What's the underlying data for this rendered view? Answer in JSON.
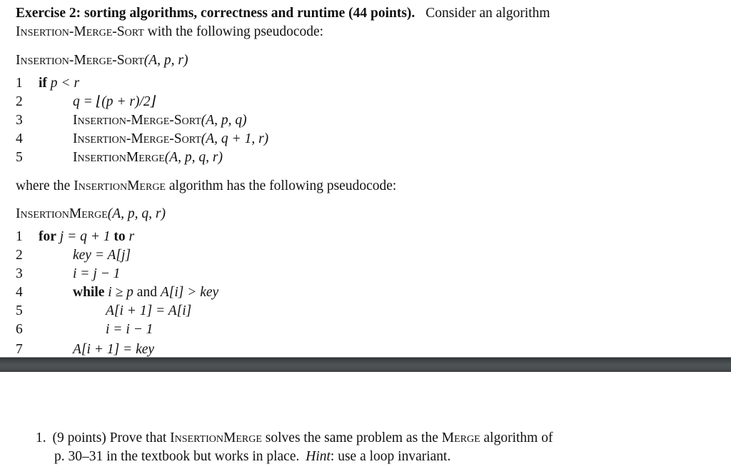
{
  "exercise": {
    "heading_bold": "Exercise 2: sorting algorithms, correctness and runtime (44 points).",
    "heading_rest": "Consider an algorithm",
    "intro_sc": "Insertion-Merge-Sort",
    "intro_rest": "with the following pseudocode:"
  },
  "ims": {
    "title_sc": "Insertion-Merge-Sort",
    "title_args": "(A, p, r)",
    "lines": [
      {
        "num": "1",
        "kw": "if",
        "text": "p < r"
      },
      {
        "num": "2",
        "text": "q = ⌊(p + r)/2⌋"
      },
      {
        "num": "3",
        "sc": "Insertion-Merge-Sort",
        "args": "(A, p, q)"
      },
      {
        "num": "4",
        "sc": "Insertion-Merge-Sort",
        "args": "(A, q + 1, r)"
      },
      {
        "num": "5",
        "sc": "InsertionMerge",
        "args": "(A, p, q, r)"
      }
    ]
  },
  "between": {
    "pre": "where the",
    "sc": "InsertionMerge",
    "post": "algorithm has the following pseudocode:"
  },
  "im": {
    "title_sc": "InsertionMerge",
    "title_args": "(A, p, q, r)",
    "lines": [
      {
        "num": "1",
        "kw": "for",
        "text": "j = q + 1",
        "kw2": "to",
        "text2": "r"
      },
      {
        "num": "2",
        "text": "key = A[j]"
      },
      {
        "num": "3",
        "text": "i = j − 1"
      },
      {
        "num": "4",
        "kw": "while",
        "text": "i ≥ p",
        "plain": "and",
        "text2": "A[i] > key"
      },
      {
        "num": "5",
        "text": "A[i + 1] = A[i]"
      },
      {
        "num": "6",
        "text": "i = i − 1"
      },
      {
        "num": "7",
        "text": "A[i + 1] = key"
      }
    ]
  },
  "question": {
    "number": "1.",
    "points": "(9 points) Prove that",
    "sc1": "InsertionMerge",
    "mid": "solves the same problem as the",
    "sc2": "Merge",
    "end1": "algorithm of",
    "line2": "p. 30–31 in the textbook but works in place.",
    "hint": "Hint",
    "hint_rest": ": use a loop invariant."
  },
  "colors": {
    "divider": "#4a4e51",
    "text": "#111111"
  }
}
